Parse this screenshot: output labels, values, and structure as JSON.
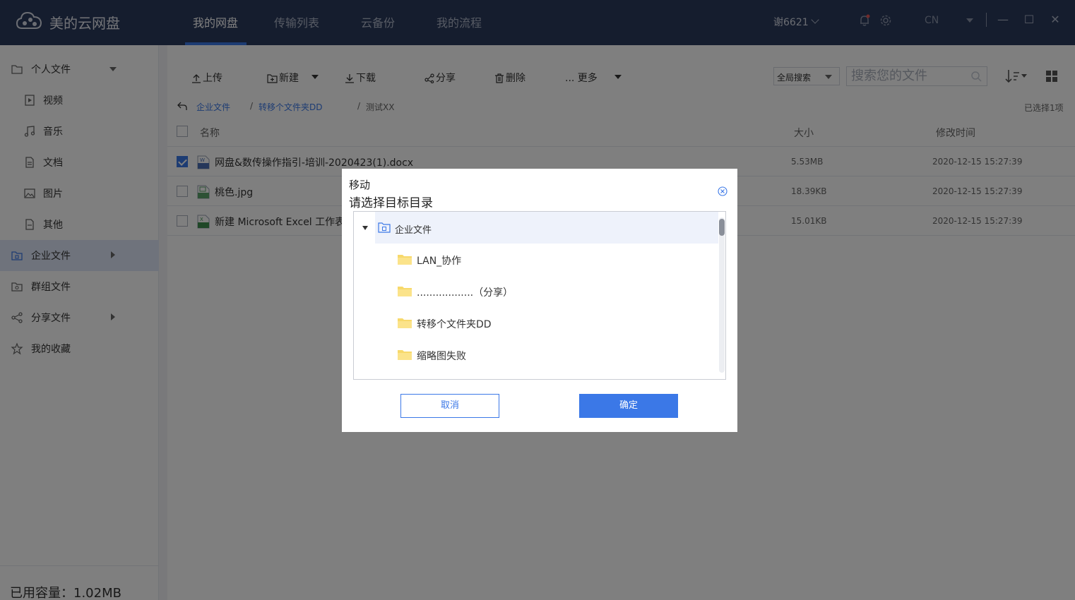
{
  "app": {
    "title": "美的云网盘"
  },
  "nav": {
    "tabs": [
      {
        "label": "我的网盘",
        "active": true
      },
      {
        "label": "传输列表",
        "active": false
      },
      {
        "label": "云备份",
        "active": false
      },
      {
        "label": "我的流程",
        "active": false
      }
    ]
  },
  "header": {
    "user": "谢6621",
    "lang": "CN",
    "bell_icon": "bell-icon",
    "gear_icon": "gear-icon"
  },
  "window": {
    "minimize": "—",
    "maximize": "☐",
    "close": "✕"
  },
  "sidebar": {
    "items": [
      {
        "label": "个人文件",
        "icon": "folder-icon",
        "expanded": true
      },
      {
        "label": "视频",
        "icon": "video-icon",
        "child": true
      },
      {
        "label": "音乐",
        "icon": "music-icon",
        "child": true
      },
      {
        "label": "文档",
        "icon": "document-icon",
        "child": true
      },
      {
        "label": "图片",
        "icon": "image-icon",
        "child": true
      },
      {
        "label": "其他",
        "icon": "other-file-icon",
        "child": true
      },
      {
        "label": "企业文件",
        "icon": "enterprise-icon",
        "active": true
      },
      {
        "label": "群组文件",
        "icon": "group-icon"
      },
      {
        "label": "分享文件",
        "icon": "share-icon"
      },
      {
        "label": "我的收藏",
        "icon": "star-icon"
      }
    ],
    "capacity": "已用容量：1.02MB"
  },
  "toolbar": {
    "upload": "上传",
    "new": "新建",
    "download": "下载",
    "share": "分享",
    "delete": "删除",
    "more": "... 更多",
    "scope": "全局搜索",
    "search_placeholder": "搜索您的文件"
  },
  "breadcrumb": {
    "items": [
      "企业文件",
      "转移个文件夹DD",
      "测试XX"
    ],
    "separator": "/"
  },
  "selection": {
    "count_text": "已选择1项"
  },
  "table": {
    "columns": {
      "name": "名称",
      "size": "大小",
      "modified": "修改时间"
    },
    "rows": [
      {
        "name": "网盘&数传操作指引-培训-2020423(1).docx",
        "size": "5.53MB",
        "modified": "2020-12-15 15:27:39",
        "checked": true,
        "type": "word"
      },
      {
        "name": "桃色.jpg",
        "size": "18.39KB",
        "modified": "2020-12-15 15:27:39",
        "checked": false,
        "type": "image"
      },
      {
        "name": "新建 Microsoft Excel 工作表",
        "size": "15.01KB",
        "modified": "2020-12-15 15:27:39",
        "checked": false,
        "type": "excel"
      }
    ]
  },
  "dialog": {
    "title": "移动",
    "subtitle": "请选择目标目录",
    "root": "企业文件",
    "folders": [
      "LAN_协作",
      "..................（分享）",
      "转移个文件夹DD",
      "缩略图失败"
    ],
    "cancel": "取消",
    "confirm": "确定"
  },
  "colors": {
    "titlebar": "#2b3a5c",
    "accent": "#3b78e7",
    "folder": "#f7d96b"
  }
}
